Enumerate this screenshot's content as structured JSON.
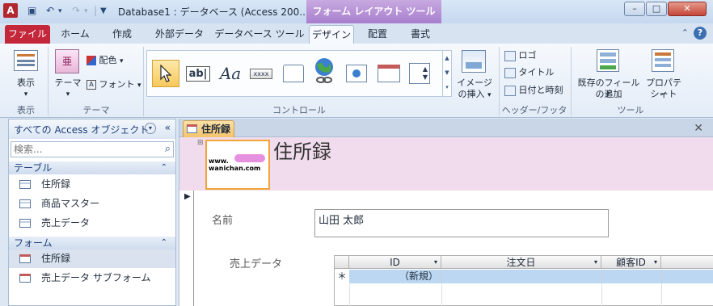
{
  "window": {
    "title": "Database1 : データベース (Access 200...",
    "context_tab": "フォーム レイアウト ツール",
    "app_icon_letter": "A",
    "buttons": {
      "minimize": "–",
      "maximize": "□",
      "close": "✕"
    }
  },
  "tabs": [
    "ファイル",
    "ホーム",
    "作成",
    "外部データ",
    "データベース ツール",
    "デザイン",
    "配置",
    "書式"
  ],
  "ribbon": {
    "view": {
      "label": "表示",
      "group": "表示"
    },
    "theme": {
      "label": "テーマ",
      "colors": "配色",
      "fonts": "フォント",
      "group": "テーマ"
    },
    "controls": {
      "group": "コントロール",
      "textbox_glyph": "ab|",
      "label_glyph": "Aa",
      "button_glyph": "xxxx"
    },
    "image": {
      "label1": "イメージ",
      "label2": "の挿入"
    },
    "header_footer": {
      "logo": "ロゴ",
      "title": "タイトル",
      "datetime": "日付と時刻",
      "group": "ヘッダー/フッター"
    },
    "tools": {
      "add_field1": "既存のフィールド",
      "add_field2": "の追加",
      "property1": "プロパティ",
      "property2": "シート",
      "group": "ツール"
    }
  },
  "nav": {
    "title": "すべての Access オブジェクト",
    "search_placeholder": "検索...",
    "sections": [
      {
        "name": "テーブル",
        "items": [
          "住所録",
          "商品マスター",
          "売上データ"
        ]
      },
      {
        "name": "フォーム",
        "items": [
          "住所録",
          "売上データ サブフォーム"
        ]
      }
    ]
  },
  "document": {
    "tab_title": "住所録",
    "form_title": "住所録",
    "logo_text1": "www.",
    "logo_text2": "wanichan.com",
    "name_label": "名前",
    "name_value": "山田 太郎",
    "sales_label": "売上データ",
    "subform": {
      "columns": [
        "ID",
        "注文日",
        "顧客ID"
      ],
      "new_row_marker": "＊",
      "new_row_text": "（新規）"
    }
  },
  "colors": {
    "file_tab": "#c4263a",
    "context_tab": "#a57ccd",
    "form_header": "#f0dcec",
    "logo_border": "#f2a33a"
  }
}
